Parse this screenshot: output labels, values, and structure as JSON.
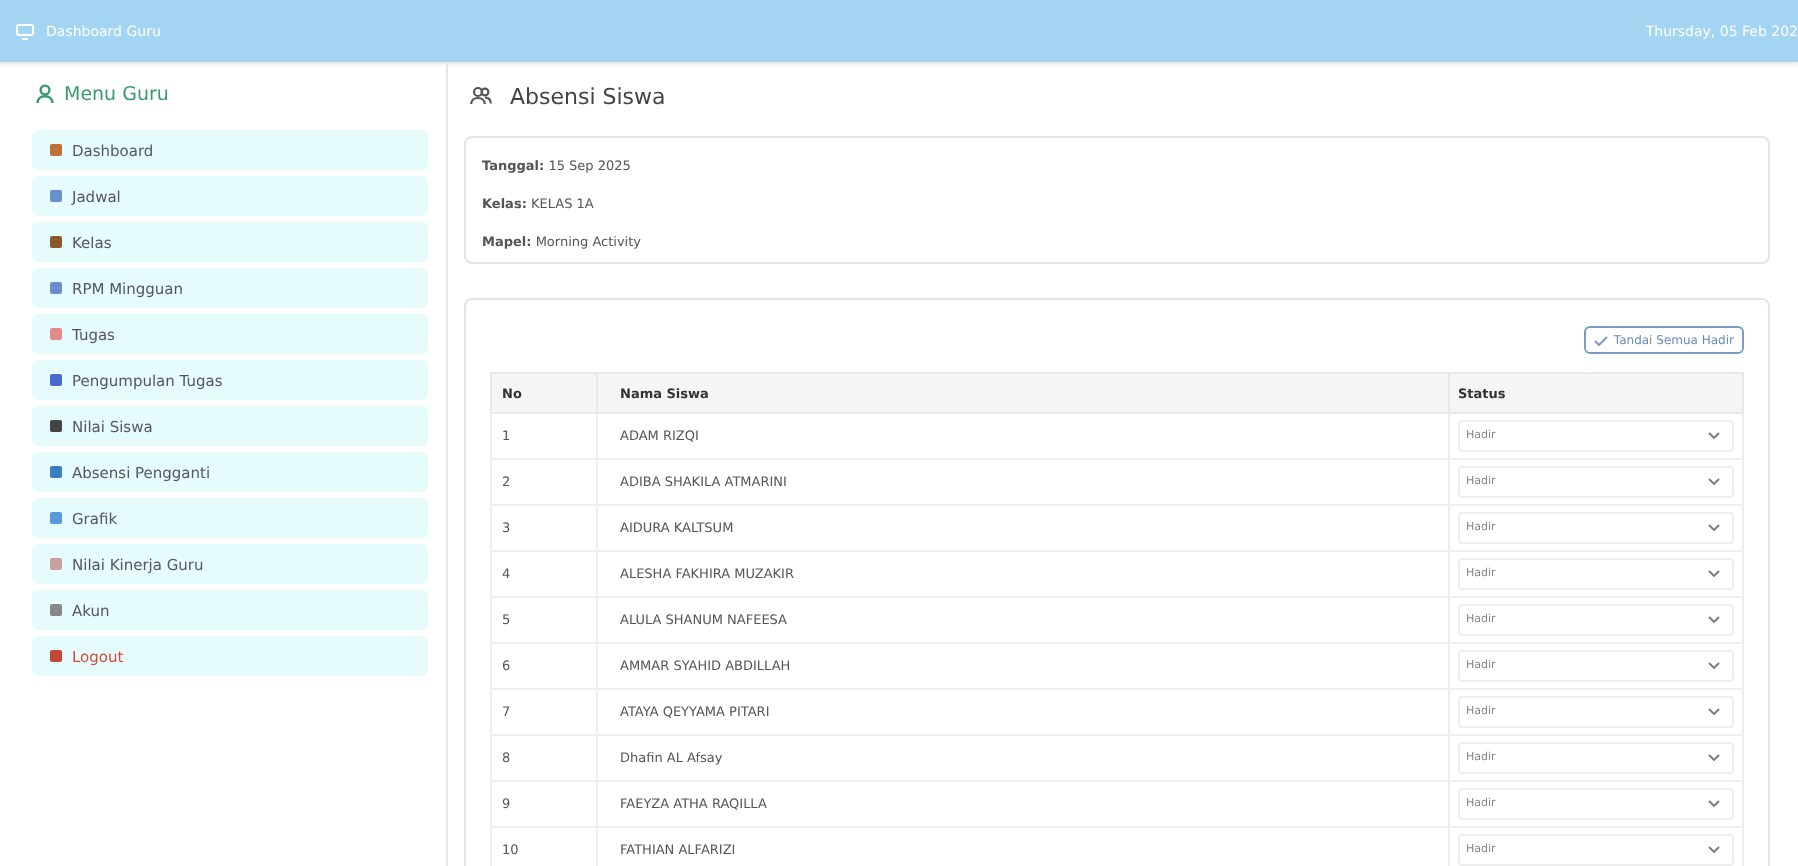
{
  "topbar": {
    "title": "Dashboard Guru",
    "date": "Thursday, 05 Feb 202"
  },
  "sidebar": {
    "title": "Menu Guru",
    "items": [
      {
        "label": "Dashboard",
        "kind": "link"
      },
      {
        "label": "Jadwal",
        "kind": "link"
      },
      {
        "label": "Kelas",
        "kind": "link"
      },
      {
        "label": "RPM Mingguan",
        "kind": "link"
      },
      {
        "label": "Tugas",
        "kind": "link"
      },
      {
        "label": "Pengumpulan Tugas",
        "kind": "link"
      },
      {
        "label": "Nilai Siswa",
        "kind": "link"
      },
      {
        "label": "Absensi Pengganti",
        "kind": "link"
      },
      {
        "label": "Grafik",
        "kind": "link"
      },
      {
        "label": "Nilai Kinerja Guru",
        "kind": "link"
      },
      {
        "label": "Akun",
        "kind": "link"
      },
      {
        "label": "Logout",
        "kind": "danger"
      }
    ]
  },
  "page_title": "Absensi Siswa",
  "info": [
    "**Tanggal:** 15 Sep 2025",
    "**Kelas:** KELAS 1A",
    "**Mapel:** Morning Activity"
  ],
  "mark_all_button": "Tandai Semua Hadir",
  "table": {
    "columns": [
      "No",
      "Nama Siswa",
      "Status"
    ],
    "rows": [
      {
        "no": "1",
        "name": "ADAM RIZQI",
        "status": "Hadir"
      },
      {
        "no": "2",
        "name": "ADIBA SHAKILA ATMARINI",
        "status": "Hadir"
      },
      {
        "no": "3",
        "name": "AIDURA KALTSUM",
        "status": "Hadir"
      },
      {
        "no": "4",
        "name": "ALESHA FAKHIRA MUZAKIR",
        "status": "Hadir"
      },
      {
        "no": "5",
        "name": "ALULA SHANUM NAFEESA",
        "status": "Hadir"
      },
      {
        "no": "6",
        "name": "AMMAR SYAHID ABDILLAH",
        "status": "Hadir"
      },
      {
        "no": "7",
        "name": "ATAYA QEYYAMA PITARI",
        "status": "Hadir"
      },
      {
        "no": "8",
        "name": "Dhafin AL Afsay",
        "status": "Hadir"
      },
      {
        "no": "9",
        "name": "FAEYZA ATHA RAQILLA",
        "status": "Hadir"
      },
      {
        "no": "10",
        "name": "FATHIAN ALFARIZI",
        "status": "Hadir"
      }
    ]
  }
}
